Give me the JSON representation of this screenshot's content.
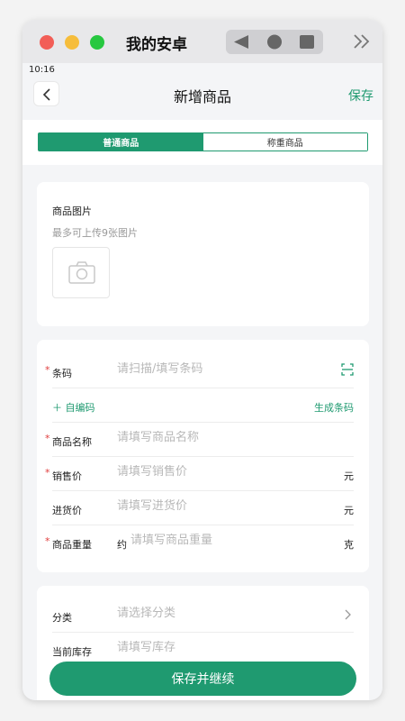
{
  "window": {
    "title": "我的安卓"
  },
  "status": {
    "time": "10:16"
  },
  "appbar": {
    "title": "新增商品",
    "save_label": "保存"
  },
  "segment": {
    "options": [
      "普通商品",
      "称重商品"
    ],
    "selected": "普通商品"
  },
  "images": {
    "title": "商品图片",
    "hint": "最多可上传9张图片"
  },
  "fields": {
    "barcode": {
      "label": "条码",
      "placeholder": "请扫描/填写条码",
      "required": true
    },
    "auto_code_label": "自编码",
    "generate_code_label": "生成条码",
    "name": {
      "label": "商品名称",
      "placeholder": "请填写商品名称",
      "required": true
    },
    "sale_price": {
      "label": "销售价",
      "placeholder": "请填写销售价",
      "unit": "元",
      "required": true
    },
    "cost_price": {
      "label": "进货价",
      "placeholder": "请填写进货价",
      "unit": "元",
      "required": false
    },
    "weight": {
      "label": "商品重量",
      "prefix": "约",
      "placeholder": "请填写商品重量",
      "unit": "克",
      "required": true
    }
  },
  "more": {
    "category": {
      "label": "分类",
      "placeholder": "请选择分类"
    },
    "stock": {
      "label": "当前库存",
      "placeholder": "请填写库存"
    }
  },
  "cta": {
    "label": "保存并继续"
  },
  "colors": {
    "accent": "#1f9a70",
    "required": "#e03d3d"
  }
}
